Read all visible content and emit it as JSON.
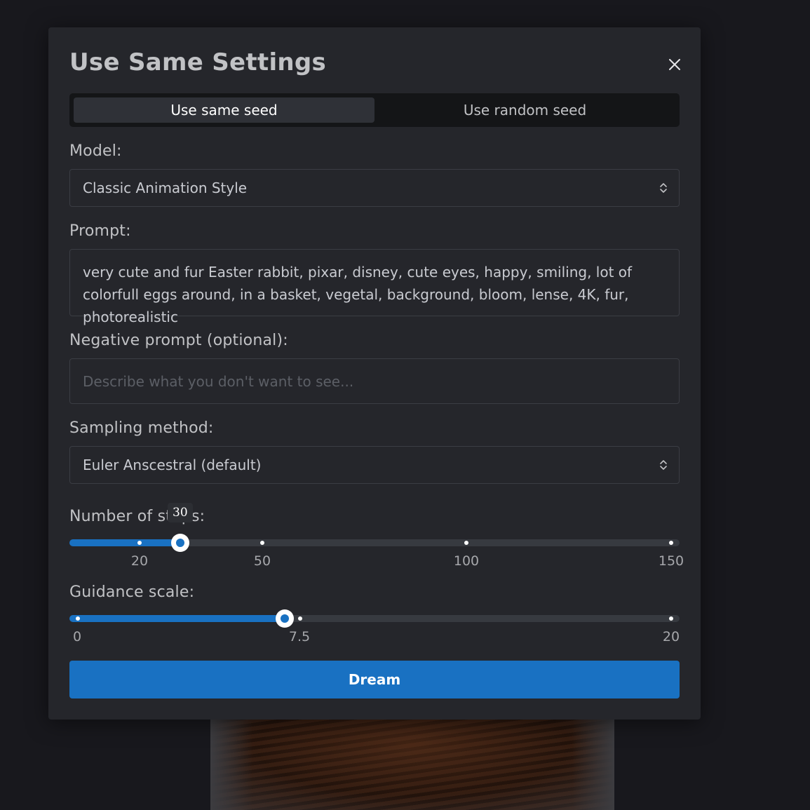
{
  "modal": {
    "title": "Use Same Settings",
    "seed_tabs": [
      {
        "label": "Use same seed",
        "active": true
      },
      {
        "label": "Use random seed",
        "active": false
      }
    ]
  },
  "model": {
    "label": "Model:",
    "value": "Classic Animation Style"
  },
  "prompt": {
    "label": "Prompt:",
    "value": "very cute and fur Easter rabbit, pixar, disney, cute eyes, happy, smiling, lot of colorfull eggs around, in a basket, vegetal, background, bloom, lense, 4K, fur, photorealistic"
  },
  "negative_prompt": {
    "label": "Negative prompt (optional):",
    "placeholder": "Describe what you don't want to see..."
  },
  "sampling": {
    "label": "Sampling method:",
    "value": "Euler Anscestral (default)"
  },
  "steps": {
    "label": "Number of steps:",
    "value": 30,
    "tooltip": "30",
    "marks": [
      "20",
      "50",
      "100",
      "150"
    ]
  },
  "guidance": {
    "label": "Guidance scale:",
    "value": 7,
    "marks": [
      "0",
      "7.5",
      "20"
    ]
  },
  "actions": {
    "dream_label": "Dream"
  },
  "colors": {
    "accent": "#1971c2",
    "modal_bg": "#25262b",
    "page_bg": "#18181d"
  }
}
